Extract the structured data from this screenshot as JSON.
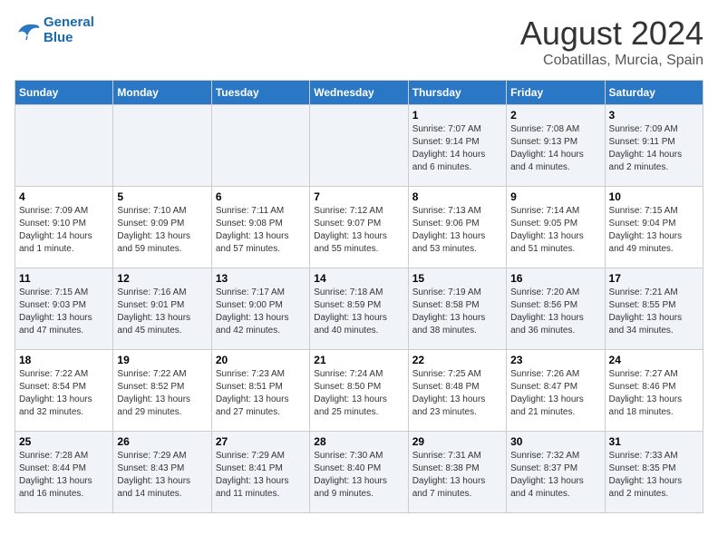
{
  "header": {
    "logo_line1": "General",
    "logo_line2": "Blue",
    "month_year": "August 2024",
    "location": "Cobatillas, Murcia, Spain"
  },
  "weekdays": [
    "Sunday",
    "Monday",
    "Tuesday",
    "Wednesday",
    "Thursday",
    "Friday",
    "Saturday"
  ],
  "weeks": [
    [
      {
        "day": "",
        "info": ""
      },
      {
        "day": "",
        "info": ""
      },
      {
        "day": "",
        "info": ""
      },
      {
        "day": "",
        "info": ""
      },
      {
        "day": "1",
        "info": "Sunrise: 7:07 AM\nSunset: 9:14 PM\nDaylight: 14 hours\nand 6 minutes."
      },
      {
        "day": "2",
        "info": "Sunrise: 7:08 AM\nSunset: 9:13 PM\nDaylight: 14 hours\nand 4 minutes."
      },
      {
        "day": "3",
        "info": "Sunrise: 7:09 AM\nSunset: 9:11 PM\nDaylight: 14 hours\nand 2 minutes."
      }
    ],
    [
      {
        "day": "4",
        "info": "Sunrise: 7:09 AM\nSunset: 9:10 PM\nDaylight: 14 hours\nand 1 minute."
      },
      {
        "day": "5",
        "info": "Sunrise: 7:10 AM\nSunset: 9:09 PM\nDaylight: 13 hours\nand 59 minutes."
      },
      {
        "day": "6",
        "info": "Sunrise: 7:11 AM\nSunset: 9:08 PM\nDaylight: 13 hours\nand 57 minutes."
      },
      {
        "day": "7",
        "info": "Sunrise: 7:12 AM\nSunset: 9:07 PM\nDaylight: 13 hours\nand 55 minutes."
      },
      {
        "day": "8",
        "info": "Sunrise: 7:13 AM\nSunset: 9:06 PM\nDaylight: 13 hours\nand 53 minutes."
      },
      {
        "day": "9",
        "info": "Sunrise: 7:14 AM\nSunset: 9:05 PM\nDaylight: 13 hours\nand 51 minutes."
      },
      {
        "day": "10",
        "info": "Sunrise: 7:15 AM\nSunset: 9:04 PM\nDaylight: 13 hours\nand 49 minutes."
      }
    ],
    [
      {
        "day": "11",
        "info": "Sunrise: 7:15 AM\nSunset: 9:03 PM\nDaylight: 13 hours\nand 47 minutes."
      },
      {
        "day": "12",
        "info": "Sunrise: 7:16 AM\nSunset: 9:01 PM\nDaylight: 13 hours\nand 45 minutes."
      },
      {
        "day": "13",
        "info": "Sunrise: 7:17 AM\nSunset: 9:00 PM\nDaylight: 13 hours\nand 42 minutes."
      },
      {
        "day": "14",
        "info": "Sunrise: 7:18 AM\nSunset: 8:59 PM\nDaylight: 13 hours\nand 40 minutes."
      },
      {
        "day": "15",
        "info": "Sunrise: 7:19 AM\nSunset: 8:58 PM\nDaylight: 13 hours\nand 38 minutes."
      },
      {
        "day": "16",
        "info": "Sunrise: 7:20 AM\nSunset: 8:56 PM\nDaylight: 13 hours\nand 36 minutes."
      },
      {
        "day": "17",
        "info": "Sunrise: 7:21 AM\nSunset: 8:55 PM\nDaylight: 13 hours\nand 34 minutes."
      }
    ],
    [
      {
        "day": "18",
        "info": "Sunrise: 7:22 AM\nSunset: 8:54 PM\nDaylight: 13 hours\nand 32 minutes."
      },
      {
        "day": "19",
        "info": "Sunrise: 7:22 AM\nSunset: 8:52 PM\nDaylight: 13 hours\nand 29 minutes."
      },
      {
        "day": "20",
        "info": "Sunrise: 7:23 AM\nSunset: 8:51 PM\nDaylight: 13 hours\nand 27 minutes."
      },
      {
        "day": "21",
        "info": "Sunrise: 7:24 AM\nSunset: 8:50 PM\nDaylight: 13 hours\nand 25 minutes."
      },
      {
        "day": "22",
        "info": "Sunrise: 7:25 AM\nSunset: 8:48 PM\nDaylight: 13 hours\nand 23 minutes."
      },
      {
        "day": "23",
        "info": "Sunrise: 7:26 AM\nSunset: 8:47 PM\nDaylight: 13 hours\nand 21 minutes."
      },
      {
        "day": "24",
        "info": "Sunrise: 7:27 AM\nSunset: 8:46 PM\nDaylight: 13 hours\nand 18 minutes."
      }
    ],
    [
      {
        "day": "25",
        "info": "Sunrise: 7:28 AM\nSunset: 8:44 PM\nDaylight: 13 hours\nand 16 minutes."
      },
      {
        "day": "26",
        "info": "Sunrise: 7:29 AM\nSunset: 8:43 PM\nDaylight: 13 hours\nand 14 minutes."
      },
      {
        "day": "27",
        "info": "Sunrise: 7:29 AM\nSunset: 8:41 PM\nDaylight: 13 hours\nand 11 minutes."
      },
      {
        "day": "28",
        "info": "Sunrise: 7:30 AM\nSunset: 8:40 PM\nDaylight: 13 hours\nand 9 minutes."
      },
      {
        "day": "29",
        "info": "Sunrise: 7:31 AM\nSunset: 8:38 PM\nDaylight: 13 hours\nand 7 minutes."
      },
      {
        "day": "30",
        "info": "Sunrise: 7:32 AM\nSunset: 8:37 PM\nDaylight: 13 hours\nand 4 minutes."
      },
      {
        "day": "31",
        "info": "Sunrise: 7:33 AM\nSunset: 8:35 PM\nDaylight: 13 hours\nand 2 minutes."
      }
    ]
  ]
}
